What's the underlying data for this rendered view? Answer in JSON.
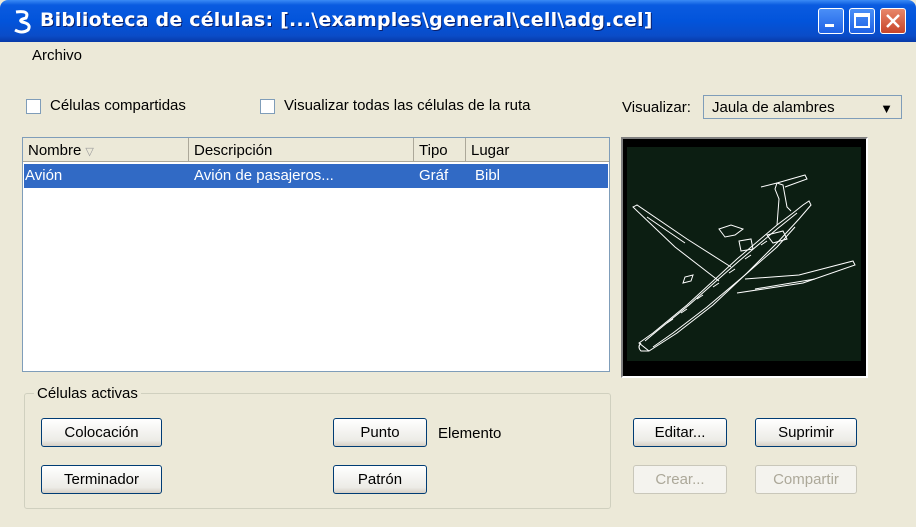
{
  "window": {
    "title": "Biblioteca de células: [...\\examples\\general\\cell\\adg.cel]"
  },
  "menu": {
    "archivo": "Archivo"
  },
  "options": {
    "shared_cells": {
      "label": "Células compartidas",
      "checked": false
    },
    "show_all_cells": {
      "label": "Visualizar todas las células de la ruta",
      "checked": false
    }
  },
  "display": {
    "label": "Visualizar:",
    "value": "Jaula de alambres"
  },
  "table": {
    "columns": [
      "Nombre",
      "Descripción",
      "Tipo",
      "Lugar"
    ],
    "rows": [
      {
        "name": "Avión",
        "description": "Avión de pasajeros...",
        "type": "Gráf",
        "place": "Bibl",
        "selected": true
      }
    ]
  },
  "active_cells": {
    "title": "Células activas",
    "placement_button": "Colocación",
    "terminator_button": "Terminador",
    "point_button": "Punto",
    "pattern_button": "Patrón",
    "element_label": "Elemento"
  },
  "actions": {
    "edit": "Editar...",
    "delete": "Suprimir",
    "create": "Crear...",
    "share": "Compartir"
  },
  "colors": {
    "selection": "#316AC5",
    "titlebar": "#0254DB",
    "preview_background": "#0c1e12",
    "wireframe": "#ffffff"
  }
}
